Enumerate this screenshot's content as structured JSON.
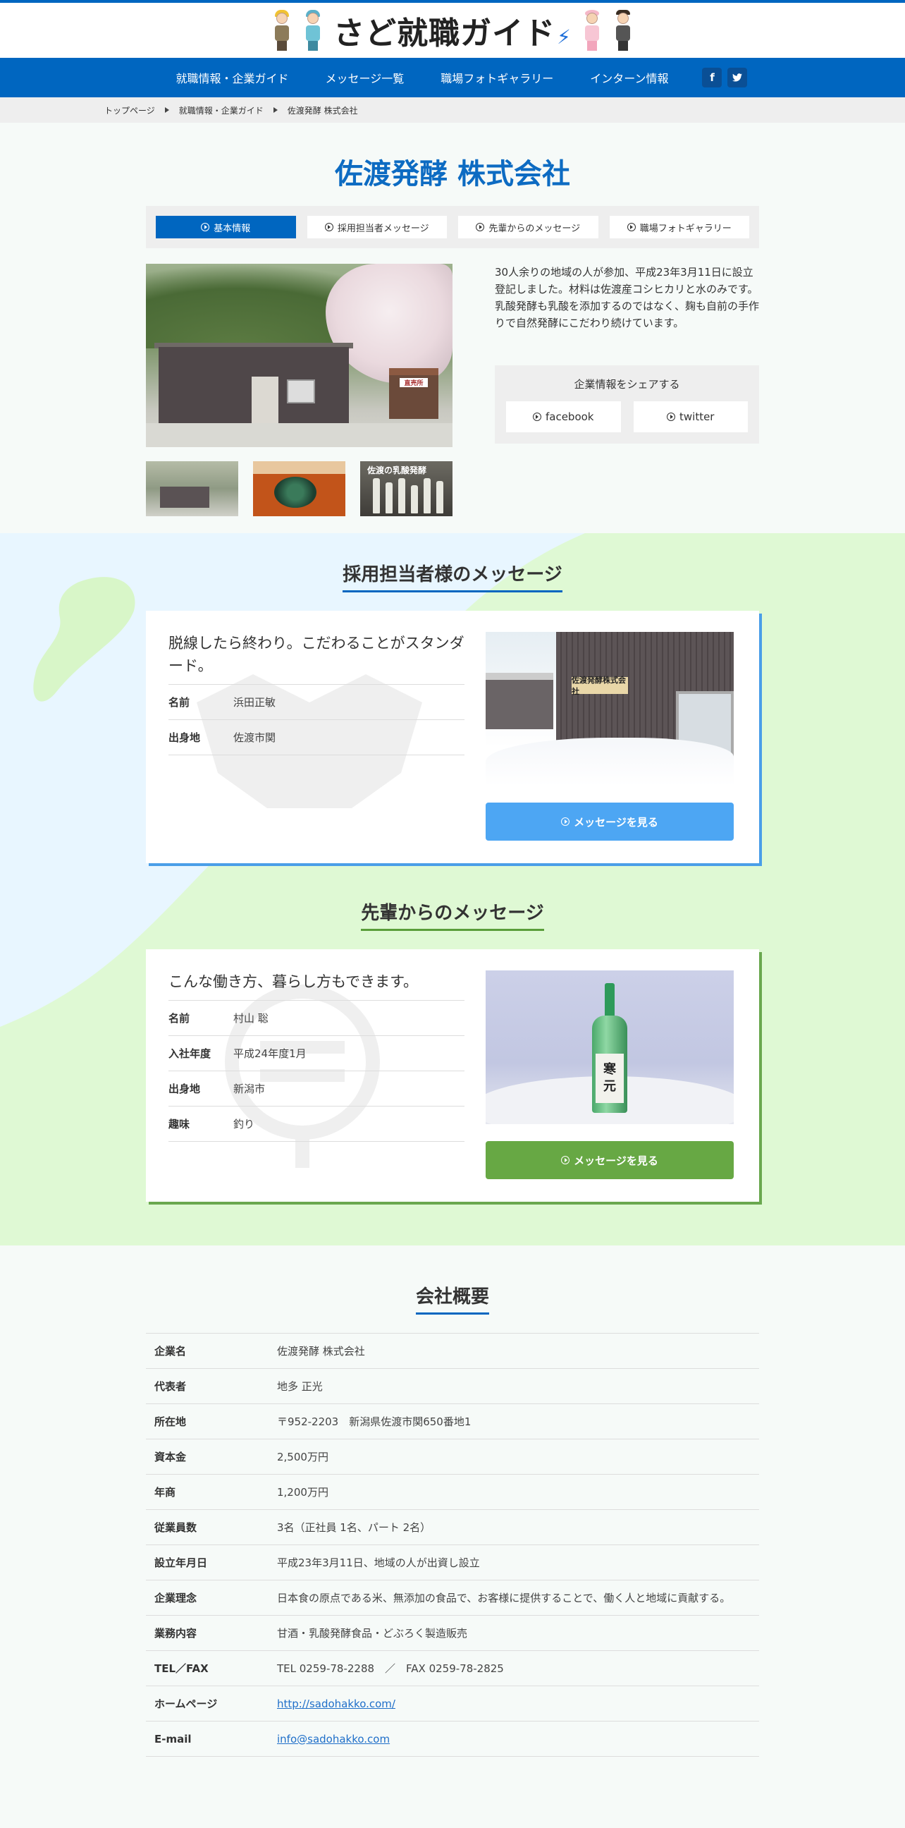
{
  "header": {
    "logo_text": "さど就職ガイド",
    "logo_mark": "⚡"
  },
  "nav": {
    "items": [
      "就職情報・企業ガイド",
      "メッセージ一覧",
      "職場フォトギャラリー",
      "インターン情報"
    ],
    "facebook_icon": "f",
    "twitter_icon": "t"
  },
  "breadcrumb": [
    "トップページ",
    "就職情報・企業ガイド",
    "佐渡発酵 株式会社"
  ],
  "company": {
    "name": "佐渡発酵 株式会社",
    "tabs": [
      "基本情報",
      "採用担当者メッセージ",
      "先輩からのメッセージ",
      "職場フォトギャラリー"
    ],
    "active_tab": 0,
    "main_photo_sign": "直売所",
    "thumb3_label": "佐渡の乳酸発酵",
    "intro": "30人余りの地域の人が参加、平成23年3月11日に設立登記しました。材料は佐渡産コシヒカリと水のみです。乳酸発酵も乳酸を添加するのではなく、麹も自前の手作りで自然発酵にこだわり続けています。",
    "share": {
      "title": "企業情報をシェアする",
      "facebook": "facebook",
      "twitter": "twitter"
    }
  },
  "recruiter_message": {
    "section_title": "採用担当者様のメッセージ",
    "quote": "脱線したら終わり。こだわることがスタンダード。",
    "rows": [
      {
        "k": "名前",
        "v": "浜田正敏"
      },
      {
        "k": "出身地",
        "v": "佐渡市関"
      }
    ],
    "photo_sign": "佐渡発酵株式会社",
    "button": "メッセージを見る"
  },
  "senior_message": {
    "section_title": "先輩からのメッセージ",
    "quote": "こんな働き方、暮らし方もできます。",
    "rows": [
      {
        "k": "名前",
        "v": "村山 聡"
      },
      {
        "k": "入社年度",
        "v": "平成24年度1月"
      },
      {
        "k": "出身地",
        "v": "新潟市"
      },
      {
        "k": "趣味",
        "v": "釣り"
      }
    ],
    "bottle_label": [
      "寒",
      "元"
    ],
    "button": "メッセージを見る"
  },
  "overview": {
    "title": "会社概要",
    "rows": [
      {
        "k": "企業名",
        "v": "佐渡発酵 株式会社"
      },
      {
        "k": "代表者",
        "v": "地多 正光"
      },
      {
        "k": "所在地",
        "v": "〒952-2203　新潟県佐渡市関650番地1"
      },
      {
        "k": "資本金",
        "v": "2,500万円"
      },
      {
        "k": "年商",
        "v": "1,200万円"
      },
      {
        "k": "従業員数",
        "v": "3名（正社員 1名、パート 2名）"
      },
      {
        "k": "設立年月日",
        "v": "平成23年3月11日、地域の人が出資し設立"
      },
      {
        "k": "企業理念",
        "v": "日本食の原点である米、無添加の食品で、お客様に提供することで、働く人と地域に貢献する。"
      },
      {
        "k": "業務内容",
        "v": "甘酒・乳酸発酵食品・どぶろく製造販売"
      },
      {
        "k": "TEL／FAX",
        "v": "TEL 0259-78-2288　／　FAX 0259-78-2825"
      },
      {
        "k": "ホームページ",
        "v": "http://sadohakko.com/"
      },
      {
        "k": "E-mail",
        "v": "info@sadohakko.com"
      }
    ]
  },
  "colors": {
    "brand_blue": "#0066c0",
    "message_blue": "#4da6f3",
    "message_green": "#67a844",
    "bg_light_blue": "#e8f6ff",
    "bg_light_green": "#dff9d4"
  }
}
